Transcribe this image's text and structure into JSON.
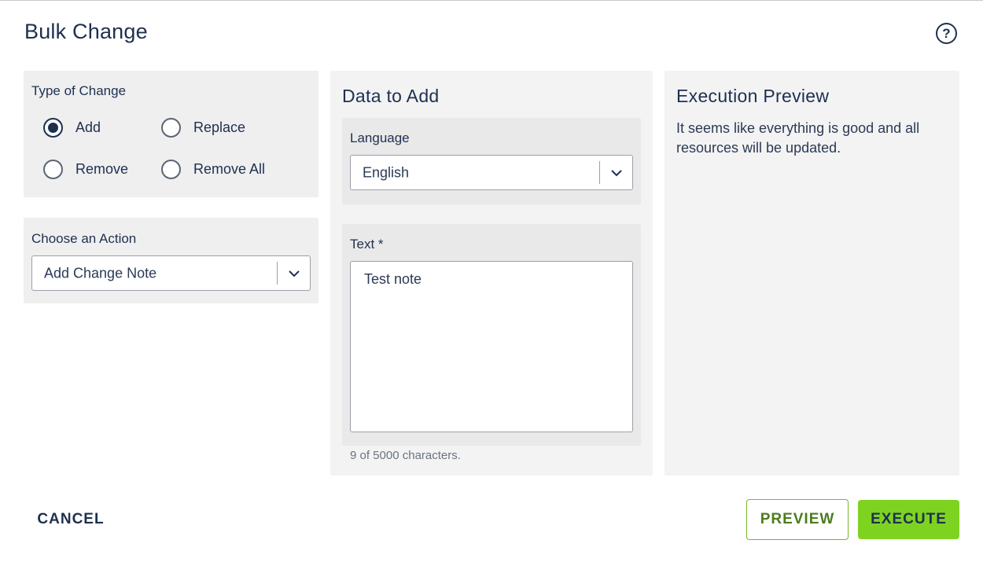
{
  "dialog": {
    "title": "Bulk Change",
    "help_icon": "question-circle-icon"
  },
  "type_of_change": {
    "label": "Type of Change",
    "options": [
      {
        "label": "Add",
        "checked": true
      },
      {
        "label": "Replace",
        "checked": false
      },
      {
        "label": "Remove",
        "checked": false
      },
      {
        "label": "Remove All",
        "checked": false
      }
    ]
  },
  "action": {
    "label": "Choose an Action",
    "selected": "Add Change Note"
  },
  "data_to_add": {
    "title": "Data to Add",
    "language": {
      "label": "Language",
      "selected": "English"
    },
    "text": {
      "label": "Text *",
      "value": "Test note",
      "counter": "9 of 5000 characters."
    }
  },
  "execution_preview": {
    "title": "Execution Preview",
    "message": "It seems like everything is good and all resources will be updated."
  },
  "footer": {
    "cancel_label": "CANCEL",
    "preview_label": "PREVIEW",
    "execute_label": "EXECUTE"
  },
  "colors": {
    "primary_text": "#1e3050",
    "execute_bg": "#7ed321",
    "preview_border": "#76b82a",
    "panel_bg": "#efefef"
  }
}
